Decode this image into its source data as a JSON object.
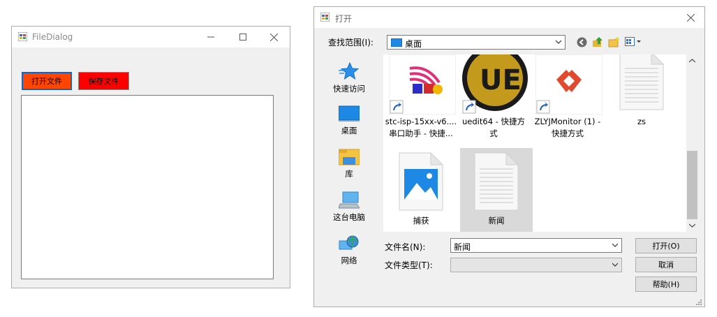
{
  "form": {
    "title": "FileDialog",
    "open_button": "打开文件",
    "save_button": "保存文件"
  },
  "dialog": {
    "title": "打开",
    "lookin_label": "查找范围(I):",
    "lookin_value": "桌面",
    "places": [
      {
        "label": "快速访问",
        "icon": "quick-access-star-icon"
      },
      {
        "label": "桌面",
        "icon": "desktop-icon"
      },
      {
        "label": "库",
        "icon": "libraries-icon"
      },
      {
        "label": "这台电脑",
        "icon": "this-pc-icon"
      },
      {
        "label": "网络",
        "icon": "network-icon"
      }
    ],
    "files": [
      {
        "line1": "stc-isp-15xx-v6....",
        "line2": "串口助手 - 快捷...",
        "icon": "stc-isp-shortcut-icon"
      },
      {
        "line1": "uedit64 - 快捷方",
        "line2": "式",
        "icon": "ultraedit-shortcut-icon"
      },
      {
        "line1": "ZLYJMonitor (1) -",
        "line2": "快捷方式",
        "icon": "zlyj-monitor-shortcut-icon"
      },
      {
        "line1": "zs",
        "line2": "",
        "icon": "text-document-icon"
      },
      {
        "line1": "捕获",
        "line2": "",
        "icon": "image-file-icon"
      },
      {
        "line1": "新闻",
        "line2": "",
        "icon": "text-document-icon",
        "selected": true
      }
    ],
    "filename_label": "文件名(N):",
    "filename_value": "新闻",
    "filetype_label": "文件类型(T):",
    "filetype_value": "",
    "open_button": "打开(O)",
    "cancel_button": "取消",
    "help_button": "帮助(H)"
  },
  "colors": {
    "open_button_bg": "#ff4500",
    "save_button_bg": "#ff0000",
    "selection_bg": "#d9d9d9"
  }
}
